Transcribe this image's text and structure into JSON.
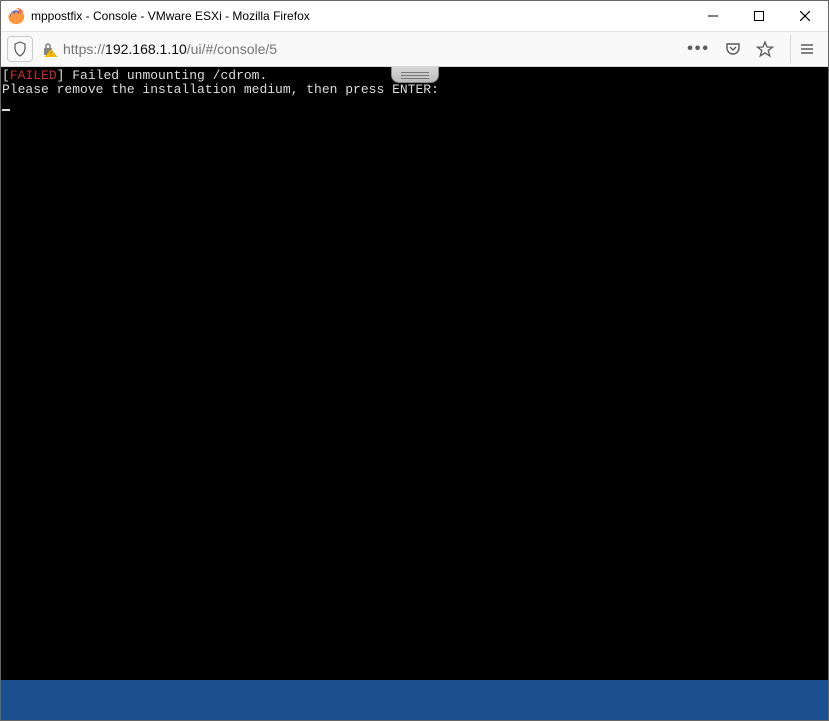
{
  "window": {
    "title": "mppostfix - Console - VMware ESXi - Mozilla Firefox"
  },
  "address": {
    "scheme": "https://",
    "ip": "192.168.1.10",
    "path": "/ui/#/console/5"
  },
  "console": {
    "bracket_open": "[",
    "failed": "FAILED",
    "bracket_close": "]",
    "line1_rest": " Failed unmounting /cdrom.",
    "line2": "Please remove the installation medium, then press ENTER:"
  }
}
